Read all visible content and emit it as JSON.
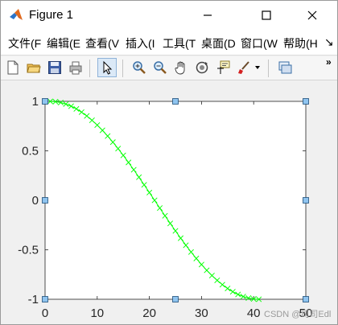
{
  "window": {
    "title": "Figure 1",
    "minimize_icon": "minimize-icon",
    "maximize_icon": "maximize-icon",
    "close_icon": "close-icon"
  },
  "menu": {
    "items": [
      "文件(F",
      "编辑(E",
      "查看(V",
      "插入(I",
      "工具(T",
      "桌面(D",
      "窗口(W",
      "帮助(H"
    ],
    "overflow_label": "↘"
  },
  "toolbar": {
    "buttons": [
      "new-figure-icon",
      "open-file-icon",
      "save-icon",
      "print-icon",
      "pointer-icon",
      "zoom-in-icon",
      "zoom-out-icon",
      "pan-hand-icon",
      "rotate-3d-icon",
      "data-cursor-icon",
      "brush-icon",
      "link-plot-icon"
    ],
    "more_label": "»"
  },
  "chart_data": {
    "type": "line",
    "title": "",
    "xlabel": "",
    "ylabel": "",
    "xlim": [
      0,
      50
    ],
    "ylim": [
      -1,
      1
    ],
    "xticks": [
      "0",
      "10",
      "20",
      "30",
      "40",
      "50"
    ],
    "yticks": [
      "1",
      "0.5",
      "0",
      "-0.5",
      "-1"
    ],
    "grid": false,
    "marker": "x",
    "line_color": "#00ff00",
    "series": [
      {
        "x": [
          1,
          2,
          3,
          4,
          5,
          6,
          7,
          8,
          9,
          10,
          11,
          12,
          13,
          14,
          15,
          16,
          17,
          18,
          19,
          20,
          21,
          22,
          23,
          24,
          25,
          26,
          27,
          28,
          29,
          30,
          31,
          32,
          33,
          34,
          35,
          36,
          37,
          38,
          39,
          40,
          41
        ],
        "y": [
          1.0,
          0.9969,
          0.9877,
          0.9724,
          0.9511,
          0.9239,
          0.891,
          0.8526,
          0.809,
          0.7604,
          0.7071,
          0.6494,
          0.5878,
          0.5225,
          0.454,
          0.3827,
          0.309,
          0.2334,
          0.1564,
          0.0785,
          0.0,
          -0.0785,
          -0.1564,
          -0.2334,
          -0.309,
          -0.3827,
          -0.454,
          -0.5225,
          -0.5878,
          -0.6494,
          -0.7071,
          -0.7604,
          -0.809,
          -0.8526,
          -0.891,
          -0.9239,
          -0.9511,
          -0.9724,
          -0.9877,
          -0.9969,
          -1.0
        ]
      }
    ],
    "selection_handles": true
  },
  "watermark": "CSDN @司司Edl"
}
